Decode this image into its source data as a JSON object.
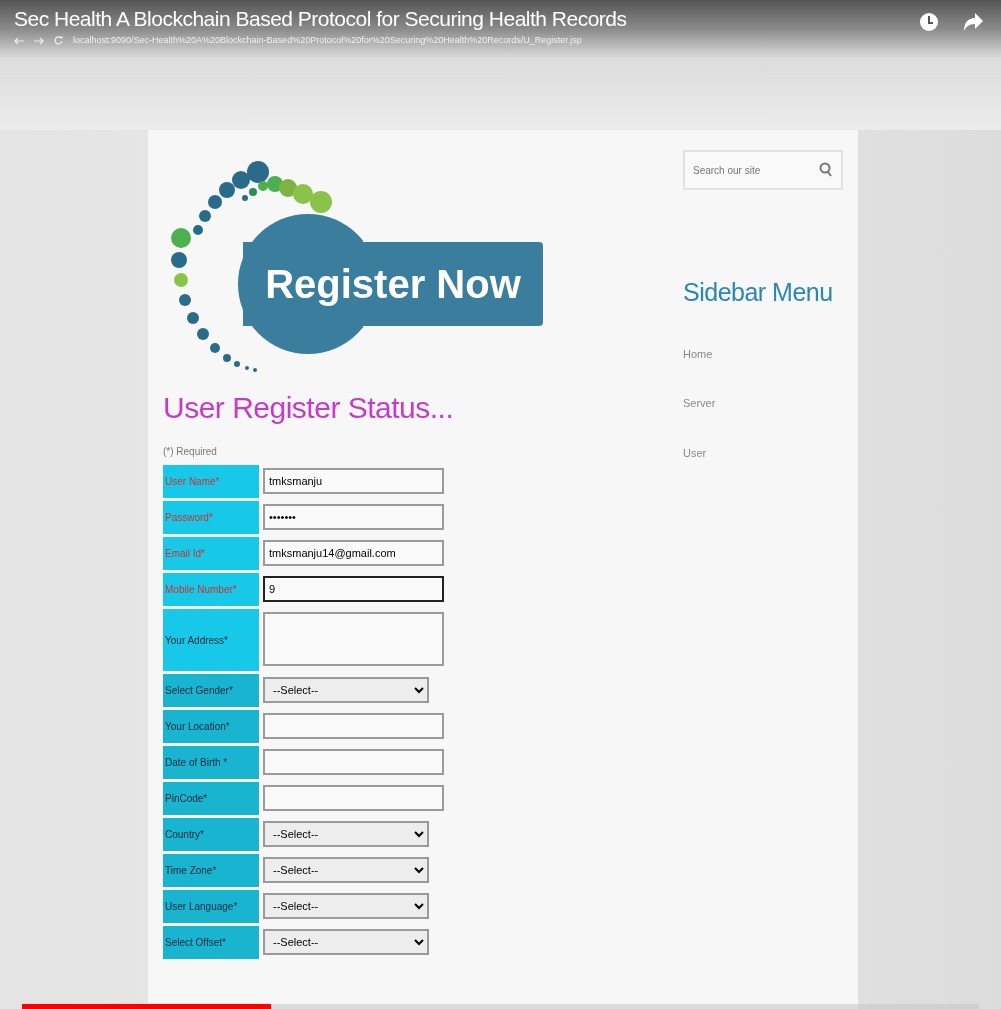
{
  "video": {
    "title": "Sec Health A Blockchain Based Protocol for Securing Health Records",
    "progress": {
      "level": 0.26
    }
  },
  "browser": {
    "url": "localhost:9090/Sec-Health%20A%20Blockchain-Based%20Protocol%20for%20Securing%20Health%20Records/U_Register.jsp"
  },
  "logo": {
    "text": "Register Now"
  },
  "heading": "User Register Status...",
  "required_note": "(*) Required",
  "form": [
    {
      "label": "User Name*",
      "kind": "text",
      "value": "tmksmanju",
      "highlighted": true,
      "focused": false
    },
    {
      "label": "Password*",
      "kind": "password",
      "value": "•••••••",
      "highlighted": true,
      "focused": false
    },
    {
      "label": "Email Id*",
      "kind": "text",
      "value": "tmksmanju14@gmail.com",
      "highlighted": true,
      "focused": false
    },
    {
      "label": "Mobile Number*",
      "kind": "text",
      "value": "9",
      "highlighted": true,
      "focused": true
    },
    {
      "label": "Your Address*",
      "kind": "textarea",
      "highlighted": false,
      "focused": false
    },
    {
      "label": "Select Gender*",
      "kind": "select",
      "value": "--Select--",
      "highlighted": false
    },
    {
      "label": "Your Location*",
      "kind": "text",
      "highlighted": false,
      "focused": false
    },
    {
      "label": "Date of Birth *",
      "kind": "text",
      "highlighted": false,
      "focused": false
    },
    {
      "label": "PinCode*",
      "kind": "text",
      "highlighted": false,
      "focused": false
    },
    {
      "label": "Country*",
      "kind": "select",
      "value": "--Select--",
      "highlighted": false
    },
    {
      "label": "Time Zone*",
      "kind": "select",
      "value": "--Select--",
      "highlighted": false
    },
    {
      "label": "User Language*",
      "kind": "select",
      "value": "--Select--",
      "highlighted": false
    },
    {
      "label": "Select Offset*",
      "kind": "select",
      "value": "--Select--",
      "highlighted": false
    }
  ],
  "sidebar": {
    "search": {
      "placeholder": "Search our site"
    },
    "title": "Sidebar Menu",
    "items": [
      "Home",
      "Server",
      "User"
    ]
  }
}
